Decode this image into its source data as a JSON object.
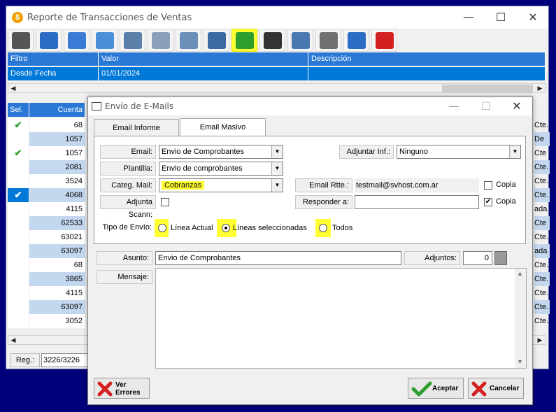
{
  "window": {
    "title": "Reporte de Transacciones de Ventas",
    "min": "—",
    "max": "☐",
    "close": "✕"
  },
  "toolbar": [
    {
      "name": "zoom-tool-icon",
      "color": "#555555"
    },
    {
      "name": "refresh-icon",
      "color": "#2b6cc4"
    },
    {
      "name": "columns-icon",
      "color": "#3a7bd5"
    },
    {
      "name": "export-icon",
      "color": "#4a90d9"
    },
    {
      "name": "print-icon",
      "color": "#5a7fa8"
    },
    {
      "name": "document-icon",
      "color": "#8aa0b8"
    },
    {
      "name": "sync-icon",
      "color": "#6a8fb8"
    },
    {
      "name": "books-icon",
      "color": "#3b6aa0"
    },
    {
      "name": "email-icon",
      "color": "#2e9e2e"
    },
    {
      "name": "calculator-icon",
      "color": "#333333"
    },
    {
      "name": "link-icon",
      "color": "#4a78b0"
    },
    {
      "name": "scanner-icon",
      "color": "#707070"
    },
    {
      "name": "edit-icon",
      "color": "#2b6cc4"
    },
    {
      "name": "delete-icon",
      "color": "#d32020"
    }
  ],
  "filter": {
    "headers": [
      "Filtro",
      "Valor",
      "Descripción"
    ],
    "row": [
      "Desde Fecha",
      "01/01/2024",
      ""
    ]
  },
  "grid": {
    "headers": [
      "Sel.",
      "Cuenta"
    ],
    "rows": [
      {
        "sel": "✔",
        "cuenta": "68",
        "right": "Cte."
      },
      {
        "sel": "",
        "cuenta": "1057",
        "right": "De"
      },
      {
        "sel": "✔",
        "cuenta": "1057",
        "right": "Cte"
      },
      {
        "sel": "",
        "cuenta": "2081",
        "right": "Cte."
      },
      {
        "sel": "",
        "cuenta": "3524",
        "right": "Cte."
      },
      {
        "sel": "✔",
        "cuenta": "4068",
        "right": "Cte."
      },
      {
        "sel": "",
        "cuenta": "4115",
        "right": "ada"
      },
      {
        "sel": "",
        "cuenta": "62533",
        "right": "Cte"
      },
      {
        "sel": "",
        "cuenta": "63021",
        "right": "Cte."
      },
      {
        "sel": "",
        "cuenta": "63097",
        "right": "ada"
      },
      {
        "sel": "",
        "cuenta": "68",
        "right": "Cte."
      },
      {
        "sel": "",
        "cuenta": "3865",
        "right": "Cte."
      },
      {
        "sel": "",
        "cuenta": "4115",
        "right": "Cte."
      },
      {
        "sel": "",
        "cuenta": "63097",
        "right": "Cte."
      },
      {
        "sel": "",
        "cuenta": "3052",
        "right": "Cte."
      }
    ]
  },
  "status": {
    "label": "Reg.:",
    "value": "3226/3226"
  },
  "dialog": {
    "title": "Envío de E-Mails",
    "tabs": [
      "Email Informe",
      "Email Masivo"
    ],
    "email_label": "Email:",
    "email_value": "Envio de Comprobantes",
    "plantilla_label": "Plantilla:",
    "plantilla_value": "Envio de comprobantes",
    "categ_label": "Categ. Mail:",
    "categ_value": "Cobranzas",
    "adjunta_label": "Adjunta Scann:",
    "adjuntar_label": "Adjuntar Inf.:",
    "adjuntar_value": "Ninguno",
    "email_rtte_label": "Email Rtte.:",
    "email_rtte_value": "testmail@svhost.com.ar",
    "copia1": "Copia",
    "responder_label": "Responder a:",
    "responder_value": "",
    "copia2": "Copia",
    "copia2_check": "✔",
    "tipo_label": "Tipo de Envío:",
    "radio1": "Línea Actual",
    "radio2": "Líneas seleccionadas",
    "radio3": "Todos",
    "asunto_label": "Asunto:",
    "asunto_value": "Envio de Comprobantes",
    "adjuntos_label": "Adjuntos:",
    "adjuntos_value": "0",
    "mensaje_label": "Mensaje:",
    "mensaje_value": "",
    "ver_errores": "Ver\nErrores",
    "aceptar": "Aceptar",
    "cancelar": "Cancelar",
    "close": "✕",
    "min": "—",
    "max": "☐"
  }
}
